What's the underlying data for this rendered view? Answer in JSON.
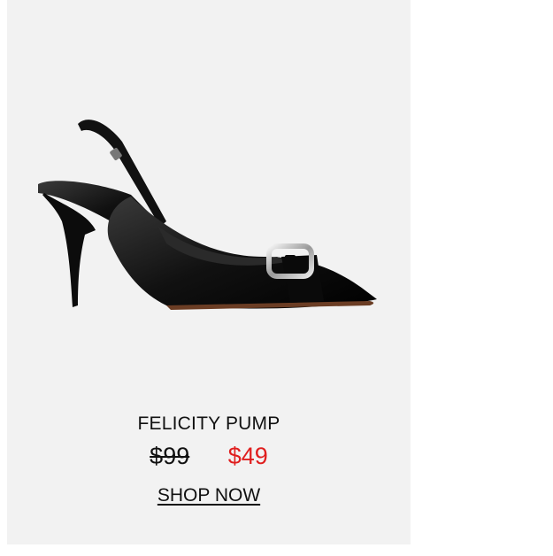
{
  "product": {
    "name": "FELICITY PUMP",
    "original_price": "$99",
    "sale_price": "$49",
    "cta_label": "SHOP NOW",
    "image_icon": "black-slingback-pump-shoe"
  },
  "colors": {
    "card_background": "#f2f2f2",
    "sale_price": "#e01e1e",
    "text": "#111111"
  }
}
